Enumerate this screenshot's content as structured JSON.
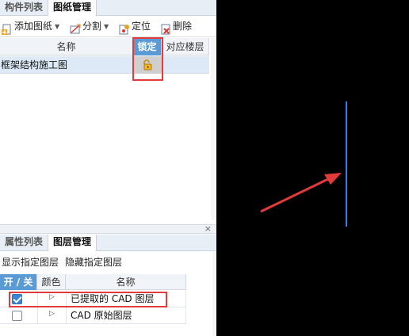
{
  "top_panel": {
    "tabs": [
      {
        "label": "构件列表",
        "active": false
      },
      {
        "label": "图纸管理",
        "active": true
      }
    ],
    "toolbar": {
      "add_label": "添加图纸",
      "split_label": "分割",
      "locate_label": "定位",
      "delete_label": "删除"
    },
    "columns": {
      "name": "名称",
      "lock": "锁定",
      "floor": "对应楼层"
    },
    "rows": [
      {
        "name": "框架结构施工图",
        "floor": ""
      }
    ]
  },
  "bottom_panel": {
    "tabs": [
      {
        "label": "属性列表",
        "active": false
      },
      {
        "label": "图层管理",
        "active": true
      }
    ],
    "toolbar": {
      "show_label": "显示指定图层",
      "hide_label": "隐藏指定图层"
    },
    "columns": {
      "onoff": "开 / 关",
      "color": "颜色",
      "name": "名称"
    },
    "layers": [
      {
        "name": "已提取的 CAD 图层",
        "checked": true
      },
      {
        "name": "CAD 原始图层",
        "checked": false
      }
    ]
  },
  "splitter": {
    "close_glyph": "×"
  },
  "colors": {
    "accent_blue": "#5b9bd5",
    "highlight_red": "#e23b3b",
    "canvas_bg": "#000000",
    "canvas_line": "#3b7ddd"
  }
}
